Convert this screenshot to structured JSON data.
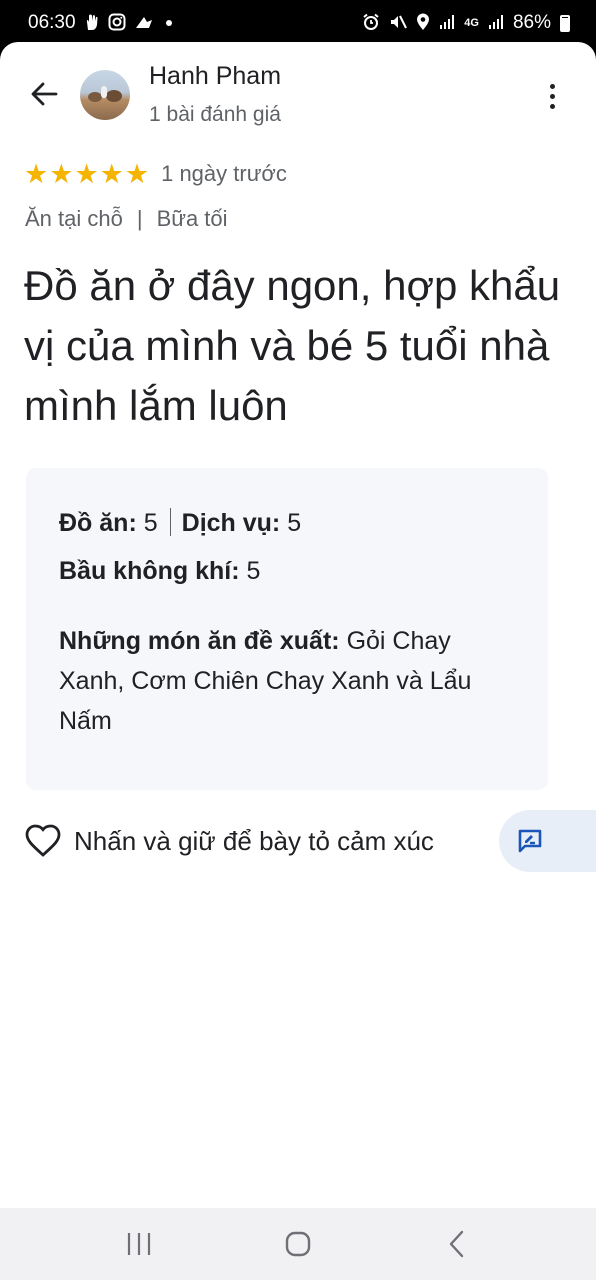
{
  "status_bar": {
    "time": "06:30",
    "left_icons": [
      "hand-icon",
      "instagram-icon",
      "cloud-icon",
      "dot-icon"
    ],
    "right_icons": [
      "alarm-icon",
      "mute-icon",
      "location-icon",
      "signal-icon",
      "4g-icon",
      "signal-icon"
    ],
    "network": "4G",
    "battery": "86%"
  },
  "header": {
    "user_name": "Hanh Pham",
    "review_count": "1 bài đánh giá"
  },
  "rating": {
    "stars": 5,
    "max_stars": 5,
    "time_ago": "1 ngày trước"
  },
  "meta": {
    "service_type": "Ăn tại chỗ",
    "meal_type": "Bữa tối"
  },
  "review": {
    "text": "Đồ ăn ở đây ngon, hợp khẩu vị của mình và bé 5 tuổi nhà mình lắm luôn"
  },
  "details": {
    "food_label": "Đồ ăn:",
    "food_value": "5",
    "service_label": "Dịch vụ:",
    "service_value": "5",
    "atmosphere_label": "Bầu không khí:",
    "atmosphere_value": "5",
    "recommend_label": "Những món ăn đề xuất:",
    "recommend_value": "Gỏi Chay Xanh, Cơm Chiên Chay Xanh và Lẩu Nấm"
  },
  "reaction": {
    "label": "Nhấn và giữ để bày tỏ cảm xúc"
  },
  "colors": {
    "star": "#f5b400",
    "card_bg": "#ffffff",
    "details_bg": "#f6f7fb",
    "feedback_bg": "#e8eef7",
    "feedback_icon": "#1a56b8",
    "text_primary": "#202124",
    "text_secondary": "#5f6368"
  }
}
